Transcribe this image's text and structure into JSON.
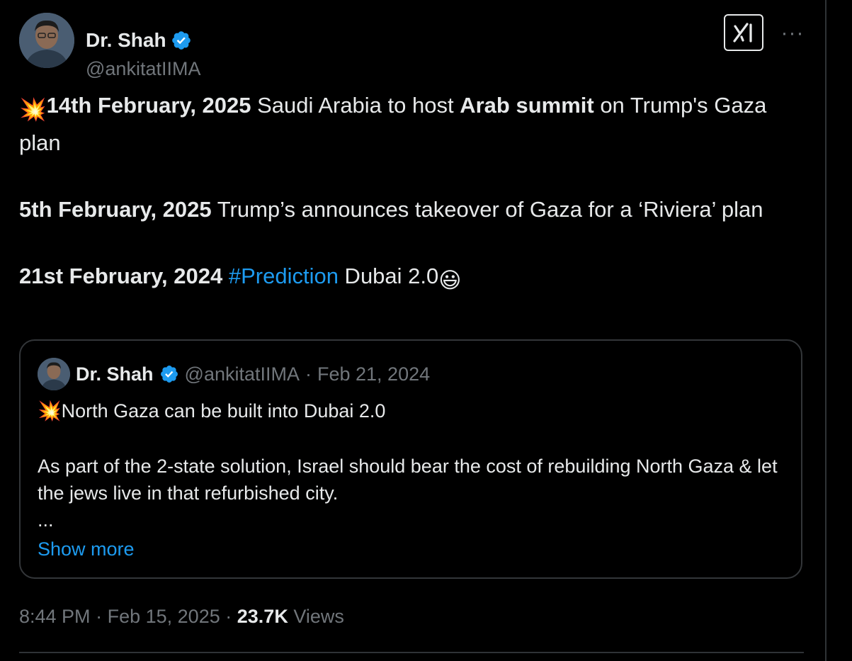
{
  "author": {
    "name": "Dr. Shah",
    "handle": "@ankitatIIMA",
    "verified": true
  },
  "actions": {
    "grok_icon": "grok-icon",
    "more_label": "···"
  },
  "tweet": {
    "line1": {
      "emoji": "💥",
      "date": "14th February, 2025",
      "text_a": " Saudi Arabia to host ",
      "bold": "Arab summit",
      "text_b": " on Trump's Gaza plan"
    },
    "line2": {
      "date": "5th February, 2025",
      "text": " Trump’s announces takeover of Gaza for a ‘Riviera’ plan"
    },
    "line3": {
      "date": "21st February, 2024",
      "hashtag": "#Prediction",
      "text": " Dubai 2.0",
      "emoji": "😃"
    }
  },
  "quote": {
    "name": "Dr. Shah",
    "handle": "@ankitatIIMA",
    "separator": "·",
    "date": "Feb 21, 2024",
    "line1_emoji": "💥",
    "line1": "North Gaza can be built into Dubai 2.0",
    "line2": "As part of the 2-state solution, Israel should bear the cost of rebuilding North Gaza & let the jews live in that refurbished city.",
    "ellipsis": "...",
    "show_more": "Show more"
  },
  "meta": {
    "time": "8:44 PM",
    "sep1": "·",
    "date": "Feb 15, 2025",
    "sep2": "·",
    "views_count": "23.7K",
    "views_label": "Views"
  },
  "colors": {
    "background": "#000000",
    "text": "#e7e9ea",
    "secondary": "#71767b",
    "accent": "#1d9bf0",
    "border": "#333639"
  }
}
